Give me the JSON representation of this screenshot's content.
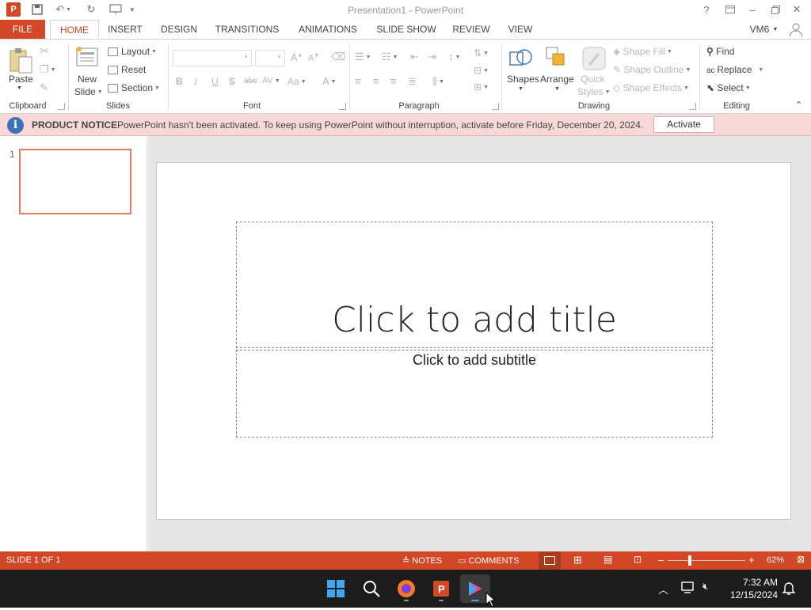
{
  "window": {
    "title": "Presentation1 - PowerPoint",
    "user": "VM6"
  },
  "tabs": [
    "FILE",
    "HOME",
    "INSERT",
    "DESIGN",
    "TRANSITIONS",
    "ANIMATIONS",
    "SLIDE SHOW",
    "REVIEW",
    "VIEW"
  ],
  "ribbon": {
    "clipboard": {
      "label": "Clipboard",
      "paste": "Paste"
    },
    "slides": {
      "label": "Slides",
      "new_slide_1": "New",
      "new_slide_2": "Slide",
      "layout": "Layout",
      "reset": "Reset",
      "section": "Section"
    },
    "font": {
      "label": "Font",
      "bold": "B",
      "italic": "I",
      "underline": "U",
      "shadow": "S",
      "strike": "abc",
      "spacing": "AV",
      "case": "Aa",
      "color": "A"
    },
    "paragraph": {
      "label": "Paragraph"
    },
    "drawing": {
      "label": "Drawing",
      "shapes": "Shapes",
      "arrange": "Arrange",
      "quick_1": "Quick",
      "quick_2": "Styles",
      "shape_fill": "Shape Fill",
      "shape_outline": "Shape Outline",
      "shape_effects": "Shape Effects"
    },
    "editing": {
      "label": "Editing",
      "find": "Find",
      "replace": "Replace",
      "select": "Select"
    }
  },
  "notice": {
    "title": "PRODUCT NOTICE",
    "message": "PowerPoint hasn't been activated. To keep using PowerPoint without interruption, activate before Friday, December 20, 2024.",
    "button": "Activate"
  },
  "thumbnails": [
    {
      "number": "1"
    }
  ],
  "slide": {
    "title_placeholder": "Click to add title",
    "subtitle_placeholder": "Click to add subtitle"
  },
  "status": {
    "slide": "SLIDE 1 OF 1",
    "notes": "NOTES",
    "comments": "COMMENTS",
    "zoom": "62%"
  },
  "taskbar": {
    "time": "7:32 AM",
    "date": "12/15/2024"
  },
  "colors": {
    "accent": "#d24726",
    "notice_bg": "#f9d8d8",
    "taskbar": "#1c1c1c"
  }
}
